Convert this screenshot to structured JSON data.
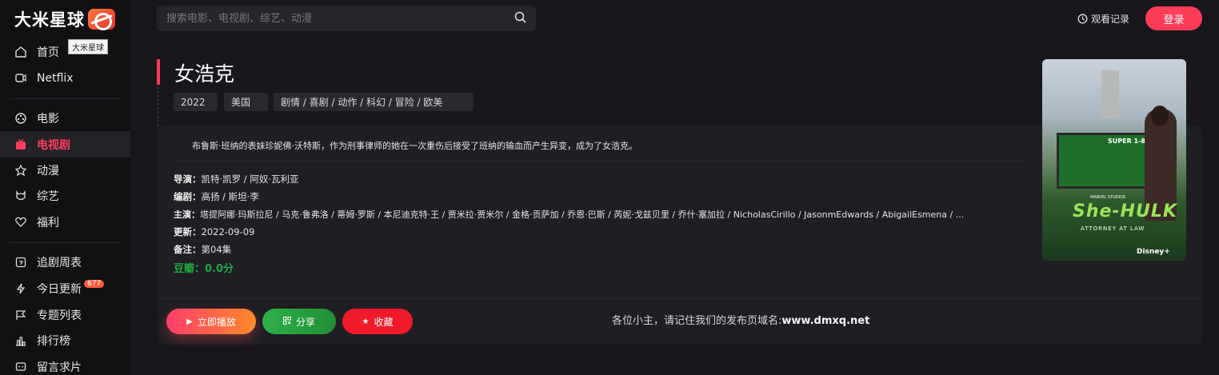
{
  "brand": {
    "logo_text": "大米星球",
    "tooltip": "大米星球"
  },
  "sidebar": {
    "items": [
      {
        "label": "首页",
        "icon": "home-icon"
      },
      {
        "label": "Netflix",
        "icon": "tv-icon"
      },
      {
        "label": "电影",
        "icon": "film-reel-icon"
      },
      {
        "label": "电视剧",
        "icon": "tv-series-icon",
        "active": true
      },
      {
        "label": "动漫",
        "icon": "anime-icon"
      },
      {
        "label": "综艺",
        "icon": "variety-icon"
      },
      {
        "label": "福利",
        "icon": "heart-icon"
      },
      {
        "label": "追剧周表",
        "icon": "calendar-icon"
      },
      {
        "label": "今日更新",
        "icon": "lightning-icon",
        "badge": "677"
      },
      {
        "label": "专题列表",
        "icon": "flag-icon"
      },
      {
        "label": "排行榜",
        "icon": "chart-icon"
      },
      {
        "label": "留言求片",
        "icon": "message-icon"
      }
    ]
  },
  "header": {
    "search_placeholder": "搜索电影、电视剧、综艺、动漫",
    "history_label": "观看记录",
    "login_label": "登录"
  },
  "detail": {
    "title": "女浩克",
    "year": "2022",
    "region": "美国",
    "genres": "剧情 /  喜剧 /  动作 /  科幻 /  冒险 /  欧美",
    "description": "布鲁斯·班纳的表妹珍妮佛·沃特斯，作为刑事律师的她在一次重伤后接受了班纳的输血而产生异变，成为了女浩克。",
    "director_label": "导演：",
    "director": "凯特·凯罗 / 阿奴·瓦利亚",
    "writer_label": "编剧：",
    "writer": "高扬 / 斯坦·李",
    "cast_label": "主演：",
    "cast": "塔提阿娜·玛斯拉尼 / 马克·鲁弗洛 / 蒂姆·罗斯 / 本尼迪克特·王 / 贾米拉·贾米尔 / 金格·贡萨加 / 乔恩·巴斯 / 芮妮·戈兹贝里 / 乔什·塞加拉 / NicholasCirillo / JasonmEdwards / AbigailEsmena / ...",
    "update_label": "更新：",
    "update": "2022-09-09",
    "note_label": "备注：",
    "note": "第04集",
    "douban": "豆瓣：0.0分"
  },
  "poster": {
    "bench_text": "SUPER 1-877 LK",
    "title_art": "She-HULK",
    "subtitle": "ATTORNEY AT LAW",
    "studio": "MARVEL STUDIOS",
    "disney": "Disney+"
  },
  "actions": {
    "play_label": "立即播放",
    "share_label": "分享",
    "fav_label": "收藏"
  },
  "notice": {
    "text": "各位小主，请记住我们的发布页域名:",
    "domain": "www.dmxq.net"
  }
}
